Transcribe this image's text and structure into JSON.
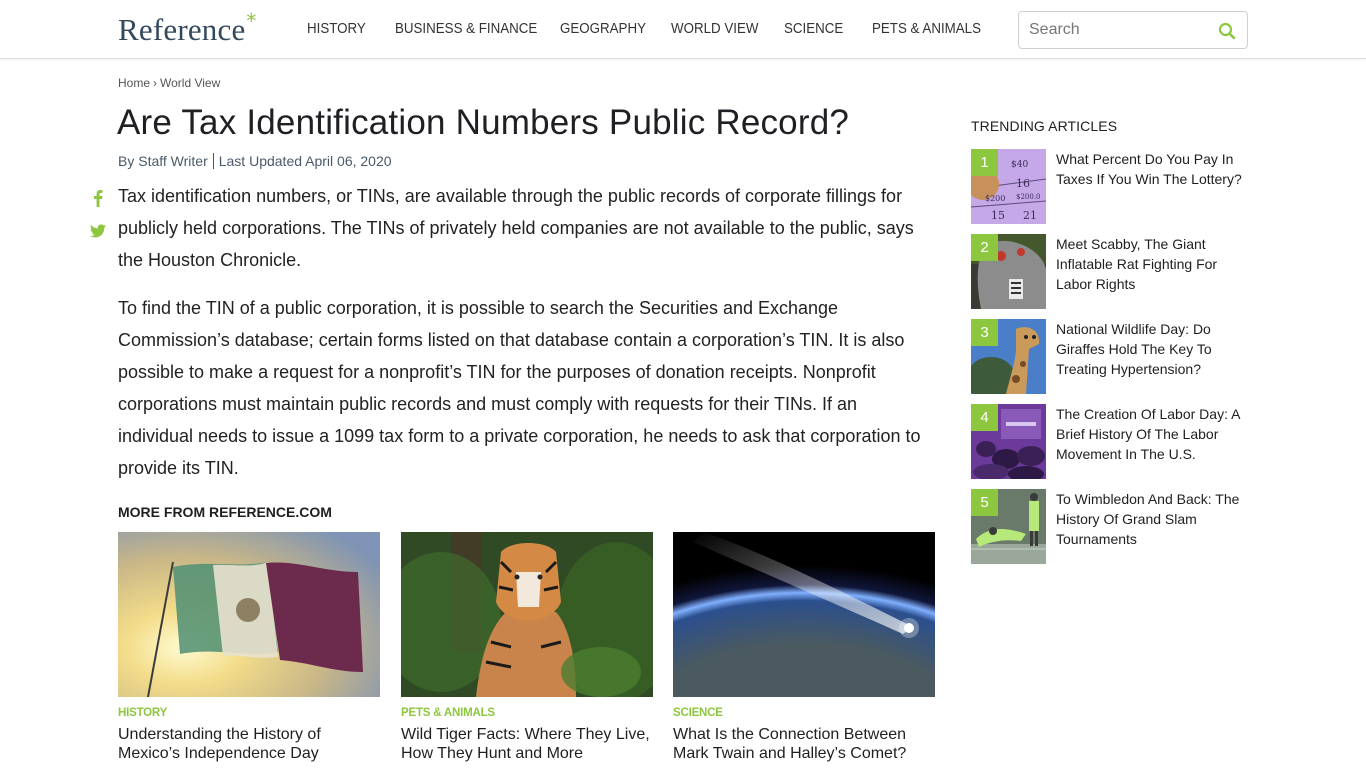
{
  "header": {
    "logo_text": "Reference",
    "logo_mark": "*",
    "nav": [
      "HISTORY",
      "BUSINESS & FINANCE",
      "GEOGRAPHY",
      "WORLD VIEW",
      "SCIENCE",
      "PETS & ANIMALS"
    ],
    "search_placeholder": "Search",
    "search_icon": "search-icon"
  },
  "breadcrumb": {
    "items": [
      "Home",
      "World View"
    ],
    "separator": "›"
  },
  "article": {
    "title": "Are Tax Identification Numbers Public Record?",
    "author": "By Staff Writer",
    "updated": "Last Updated April 06, 2020",
    "social": [
      "facebook-icon",
      "twitter-icon"
    ],
    "paragraphs": [
      "Tax identification numbers, or TINs, are available through the public records of corporate fillings for publicly held corporations. The TINs of privately held companies are not available to the public, says the Houston Chronicle.",
      "To find the TIN of a public corporation, it is possible to search the Securities and Exchange Commission’s database; certain forms listed on that database contain a corporation’s TIN. It is also possible to make a request for a nonprofit’s TIN for the purposes of donation receipts. Nonprofit corporations must maintain public records and must comply with requests for their TINs. If an individual needs to issue a 1099 tax form to a private corporation, he needs to ask that corporation to provide its TIN."
    ]
  },
  "more_from": {
    "heading": "MORE FROM REFERENCE.COM",
    "cards": [
      {
        "category": "HISTORY",
        "title": "Understanding the History of Mexico’s Independence Day",
        "image": "mexican-flag-image"
      },
      {
        "category": "PETS & ANIMALS",
        "title": "Wild Tiger Facts: Where They Live, How They Hunt and More",
        "image": "tiger-image"
      },
      {
        "category": "SCIENCE",
        "title": "What Is the Connection Between Mark Twain and Halley’s Comet?",
        "image": "comet-image"
      }
    ]
  },
  "trending": {
    "heading": "TRENDING ARTICLES",
    "items": [
      {
        "rank": "1",
        "title": "What Percent Do You Pay In Taxes If You Win The Lottery?"
      },
      {
        "rank": "2",
        "title": "Meet Scabby, The Giant Inflatable Rat Fighting For Labor Rights"
      },
      {
        "rank": "3",
        "title": "National Wildlife Day: Do Giraffes Hold The Key To Treating Hypertension?"
      },
      {
        "rank": "4",
        "title": "The Creation Of Labor Day: A Brief History Of The Labor Movement In The U.S."
      },
      {
        "rank": "5",
        "title": "To Wimbledon And Back: The History Of Grand Slam Tournaments"
      }
    ]
  },
  "colors": {
    "accent": "#8dc63f",
    "logo": "#34495e",
    "text": "#1f1f1f"
  }
}
